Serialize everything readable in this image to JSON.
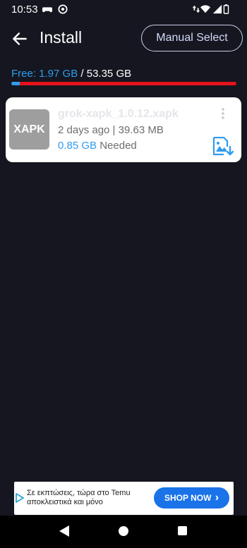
{
  "status": {
    "time": "10:53",
    "left_icons": [
      "gamepad-icon",
      "vpn-icon"
    ],
    "right_icons": [
      "data-arrows-icon",
      "wifi-icon",
      "signal-icon",
      "battery-icon"
    ]
  },
  "appbar": {
    "title": "Install",
    "manual_select_label": "Manual Select"
  },
  "storage": {
    "free_label": "Free: 1.97 GB",
    "separator": "/",
    "total_label": "53.35 GB",
    "used_fraction": 0.037
  },
  "file": {
    "icon_label": "XAPK",
    "name": "grok-xapk_1.0.12.xapk",
    "meta": "2 days ago | 39.63 MB",
    "needed_size": "0.85 GB",
    "needed_label": "Needed"
  },
  "ad": {
    "text": "Σε εκπτώσεις, τώρα στο Temu αποκλειστικά και μόνο",
    "cta_label": "SHOP NOW",
    "cta_arrow": "›"
  },
  "colors": {
    "background": "#15161f",
    "accent": "#2f9cf0",
    "used_bar": "#e3121b",
    "cta": "#1a73e8"
  }
}
